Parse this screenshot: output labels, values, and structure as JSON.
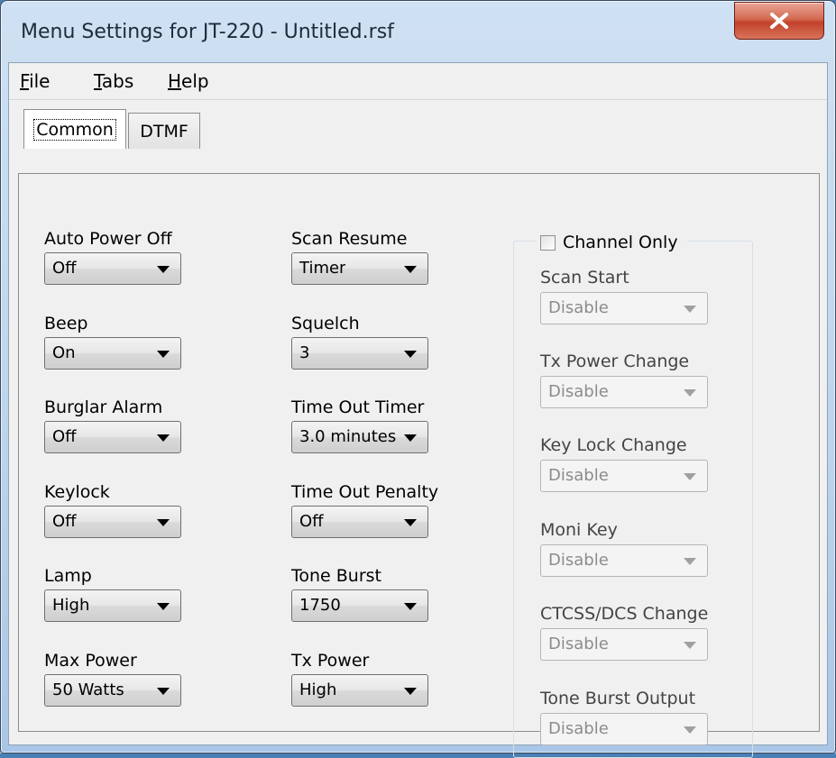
{
  "window": {
    "title": "Menu Settings for JT-220 - Untitled.rsf"
  },
  "menu": [
    {
      "accel": "F",
      "rest": "ile"
    },
    {
      "accel": "T",
      "rest": "abs"
    },
    {
      "accel": "H",
      "rest": "elp"
    }
  ],
  "tabs": [
    {
      "label": "Common",
      "active": true
    },
    {
      "label": "DTMF",
      "active": false
    }
  ],
  "column1": [
    {
      "label": "Auto Power Off",
      "value": "Off"
    },
    {
      "label": "Beep",
      "value": "On"
    },
    {
      "label": "Burglar Alarm",
      "value": "Off"
    },
    {
      "label": "Keylock",
      "value": "Off"
    },
    {
      "label": "Lamp",
      "value": "High"
    },
    {
      "label": "Max Power",
      "value": "50 Watts"
    }
  ],
  "column2": [
    {
      "label": "Scan Resume",
      "value": "Timer"
    },
    {
      "label": "Squelch",
      "value": "3"
    },
    {
      "label": "Time Out Timer",
      "value": "3.0 minutes"
    },
    {
      "label": "Time Out Penalty",
      "value": "Off"
    },
    {
      "label": "Tone Burst",
      "value": "1750"
    },
    {
      "label": "Tx Power",
      "value": "High"
    }
  ],
  "channel_only": {
    "label": "Channel Only",
    "checked": false,
    "items": [
      {
        "label": "Scan Start",
        "value": "Disable"
      },
      {
        "label": "Tx Power Change",
        "value": "Disable"
      },
      {
        "label": "Key Lock Change",
        "value": "Disable"
      },
      {
        "label": "Moni Key",
        "value": "Disable"
      },
      {
        "label": "CTCSS/DCS Change",
        "value": "Disable"
      },
      {
        "label": "Tone Burst Output",
        "value": "Disable"
      }
    ]
  },
  "colors": {
    "close_button": "#c2412a",
    "titlebar": "#bcd4ec",
    "disabled_text": "#8c8c8c"
  }
}
